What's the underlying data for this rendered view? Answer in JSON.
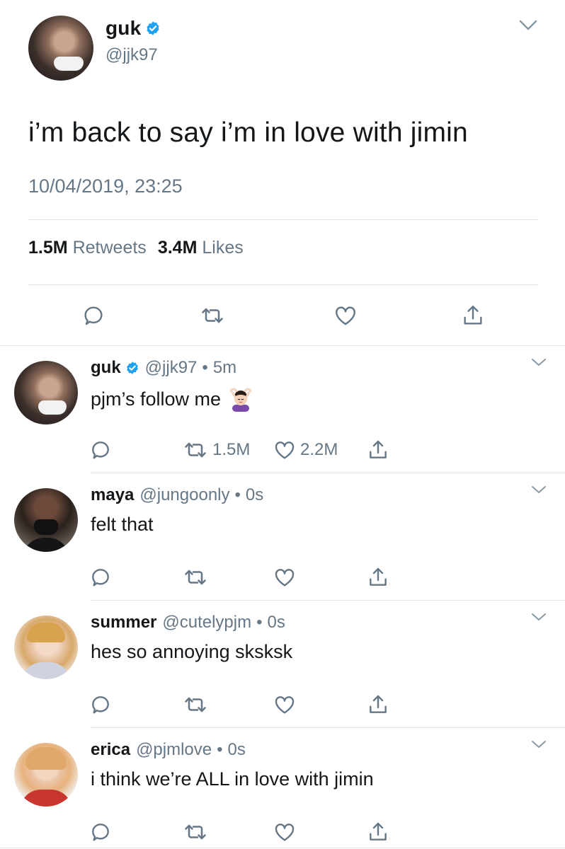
{
  "main_tweet": {
    "name": "guk",
    "handle": "@jjk97",
    "text": "i’m back to say i’m in love with jimin",
    "timestamp": "10/04/2019, 23:25",
    "retweets_count": "1.5M",
    "retweets_label": "Retweets",
    "likes_count": "3.4M",
    "likes_label": "Likes",
    "verified": true,
    "actions": [
      "reply-icon",
      "retweet-icon",
      "like-icon",
      "share-icon"
    ]
  },
  "replies": [
    {
      "name": "guk",
      "verified": true,
      "handle": "@jjk97",
      "separator": "•",
      "time": "5m",
      "text": "pjm’s follow me",
      "emoji": "woman-gesturing-ok-emoji",
      "retweets": "1.5M",
      "likes": "2.2M"
    },
    {
      "name": "maya",
      "handle": "@jungoonly",
      "separator": "•",
      "time": "0s",
      "text": "felt that"
    },
    {
      "name": "summer",
      "handle": "@cutelypjm",
      "separator": "•",
      "time": "0s",
      "text": "hes so annoying sksksk"
    },
    {
      "name": "erica",
      "handle": "@pjmlove",
      "separator": "•",
      "time": "0s",
      "text": "i think we’re ALL in love with jimin"
    }
  ],
  "colors": {
    "text": "#14171a",
    "secondary": "#657786",
    "verified_blue": "#1da1f2",
    "divider": "#dfe3e6"
  }
}
